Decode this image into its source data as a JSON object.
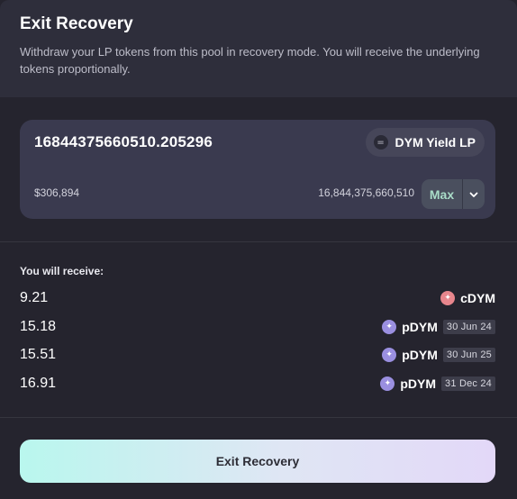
{
  "header": {
    "title": "Exit Recovery",
    "subtitle": "Withdraw your LP tokens from this pool in recovery mode. You will receive the underlying tokens proportionally."
  },
  "input": {
    "amount": "16844375660510.205296",
    "token_label": "DYM Yield LP",
    "token_icon": "equals-icon",
    "usd_value": "$306,894",
    "balance": "16,844,375,660,510",
    "max_label": "Max"
  },
  "receive": {
    "label": "You will receive:",
    "rows": [
      {
        "amount": "9.21",
        "symbol": "cDYM",
        "date": ""
      },
      {
        "amount": "15.18",
        "symbol": "pDYM",
        "date": "30 Jun 24"
      },
      {
        "amount": "15.51",
        "symbol": "pDYM",
        "date": "30 Jun 25"
      },
      {
        "amount": "16.91",
        "symbol": "pDYM",
        "date": "31 Dec 24"
      }
    ]
  },
  "actions": {
    "exit_label": "Exit Recovery"
  },
  "colors": {
    "background": "#25242e",
    "header": "#2e2e3b",
    "card": "#3a3a4f",
    "cdym": "#e8868d",
    "pdym": "#9a8fe0",
    "max_text": "#a9dcc8"
  }
}
